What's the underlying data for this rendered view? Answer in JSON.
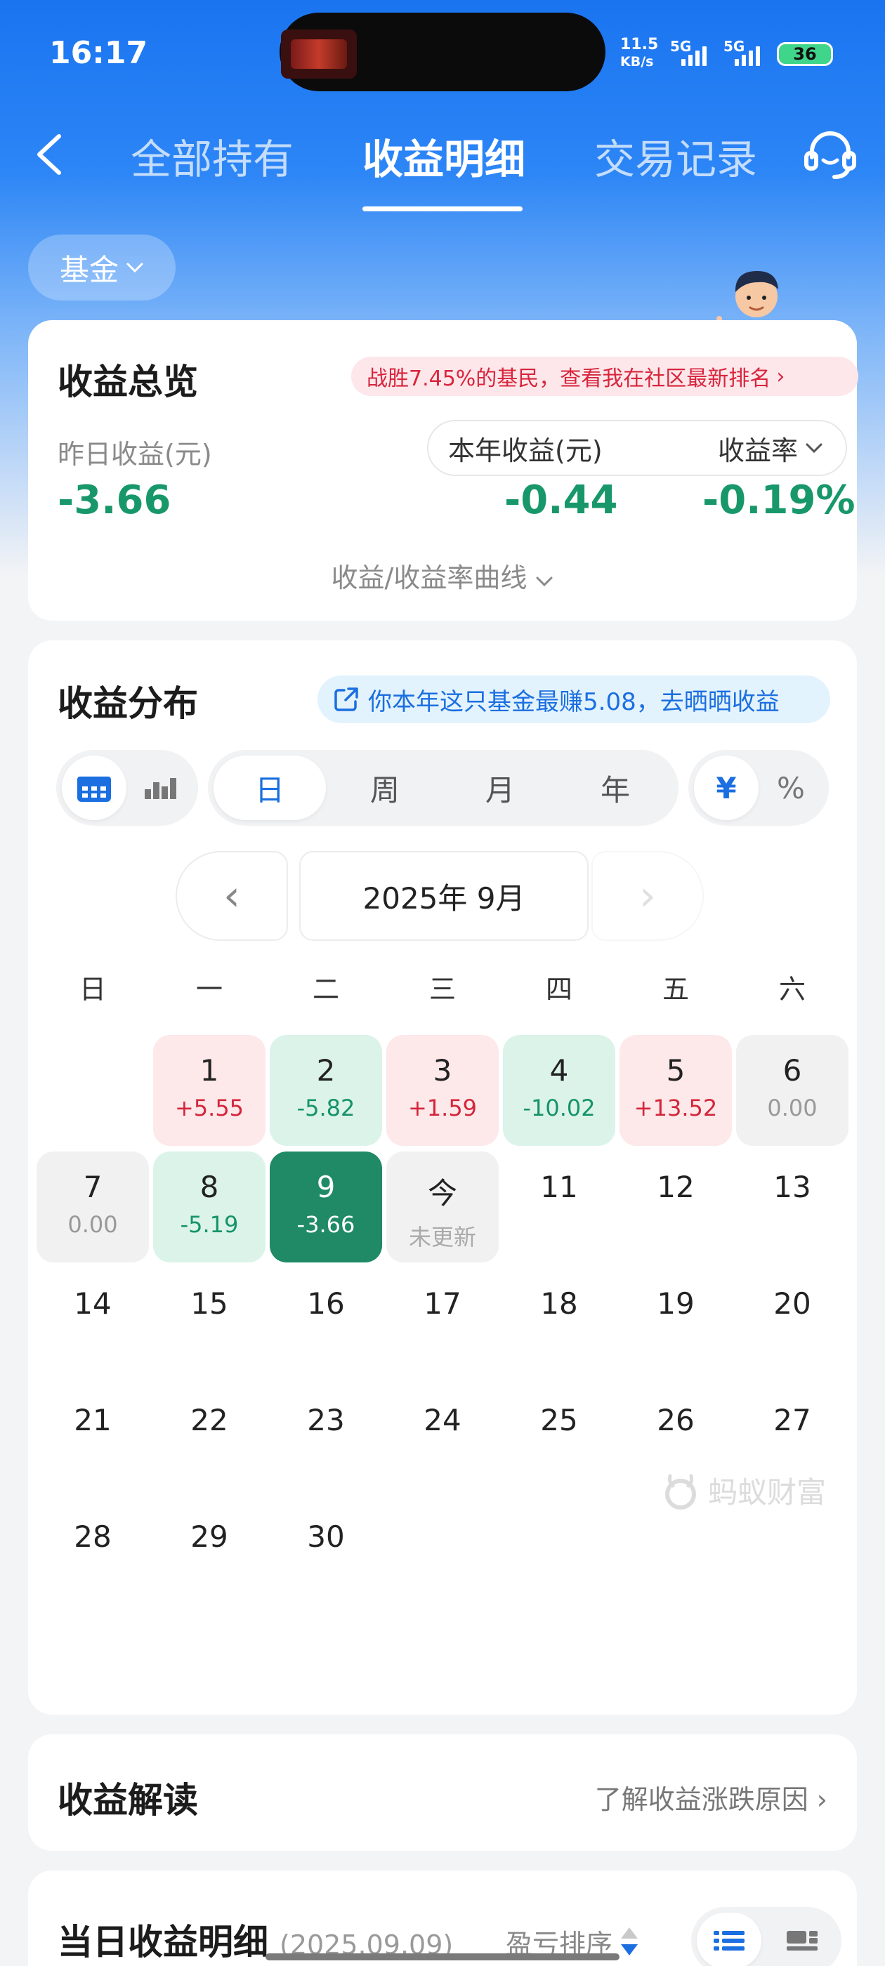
{
  "status": {
    "time": "16:17",
    "net_speed_value": "11.5",
    "net_speed_unit": "KB/s",
    "sim1": "5G",
    "sim2": "5G",
    "battery": "36"
  },
  "nav": {
    "tabs": [
      "全部持有",
      "收益明细",
      "交易记录"
    ],
    "active_tab": 1
  },
  "filter": {
    "fund_label": "基金"
  },
  "overview": {
    "title": "收益总览",
    "promo": "战胜7.45%的基民，查看我在社区最新排名",
    "yesterday_label": "昨日收益(元)",
    "yesterday_value": "-3.66",
    "year_label": "本年收益(元)",
    "rate_label": "收益率",
    "year_value": "-0.44",
    "rate_value": "-0.19%",
    "curve_link": "收益/收益率曲线"
  },
  "distribution": {
    "title": "收益分布",
    "share": "你本年这只基金最赚5.08，去晒晒收益",
    "periods": [
      "日",
      "周",
      "月",
      "年"
    ],
    "units": [
      "¥",
      "%"
    ],
    "month": "2025年 9月",
    "weekdays": [
      "日",
      "一",
      "二",
      "三",
      "四",
      "五",
      "六"
    ],
    "days": [
      {
        "d": "1",
        "v": "+5.55",
        "t": "pos"
      },
      {
        "d": "2",
        "v": "-5.82",
        "t": "neg"
      },
      {
        "d": "3",
        "v": "+1.59",
        "t": "pos"
      },
      {
        "d": "4",
        "v": "-10.02",
        "t": "neg"
      },
      {
        "d": "5",
        "v": "+13.52",
        "t": "pos"
      },
      {
        "d": "6",
        "v": "0.00",
        "t": "zero"
      },
      {
        "d": "7",
        "v": "0.00",
        "t": "zero"
      },
      {
        "d": "8",
        "v": "-5.19",
        "t": "neg"
      },
      {
        "d": "9",
        "v": "-3.66",
        "t": "sel"
      },
      {
        "d": "今",
        "v": "未更新",
        "t": "today"
      },
      {
        "d": "11"
      },
      {
        "d": "12"
      },
      {
        "d": "13"
      },
      {
        "d": "14"
      },
      {
        "d": "15"
      },
      {
        "d": "16"
      },
      {
        "d": "17"
      },
      {
        "d": "18"
      },
      {
        "d": "19"
      },
      {
        "d": "20"
      },
      {
        "d": "21"
      },
      {
        "d": "22"
      },
      {
        "d": "23"
      },
      {
        "d": "24"
      },
      {
        "d": "25"
      },
      {
        "d": "26"
      },
      {
        "d": "27"
      },
      {
        "d": "28"
      },
      {
        "d": "29"
      },
      {
        "d": "30"
      }
    ],
    "watermark": "蚂蚁财富"
  },
  "reading": {
    "title": "收益解读",
    "link": "了解收益涨跌原因"
  },
  "detail": {
    "title": "当日收益明细",
    "date": "(2025.09.09)",
    "sort_label": "盈亏排序"
  }
}
